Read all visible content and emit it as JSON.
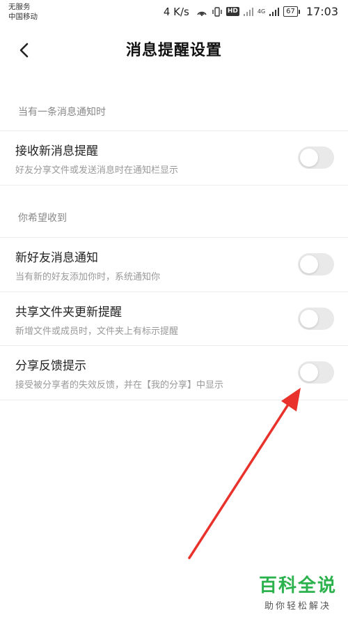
{
  "status_bar": {
    "carrier_line1": "无服务",
    "carrier_line2": "中国移动",
    "net_speed": "4 K/s",
    "hd_label": "HD",
    "net_type": "4G",
    "battery": "67",
    "time": "17:03"
  },
  "header": {
    "title": "消息提醒设置"
  },
  "sections": [
    {
      "label": "当有一条消息通知时",
      "rows": [
        {
          "title": "接收新消息提醒",
          "desc": "好友分享文件或发送消息时在通知栏显示",
          "enabled": false
        }
      ]
    },
    {
      "label": "你希望收到",
      "rows": [
        {
          "title": "新好友消息通知",
          "desc": "当有新的好友添加你时，系统通知你",
          "enabled": false
        },
        {
          "title": "共享文件夹更新提醒",
          "desc": "新增文件或成员时，文件夹上有标示提醒",
          "enabled": false
        },
        {
          "title": "分享反馈提示",
          "desc": "接受被分享者的失效反馈，并在【我的分享】中显示",
          "enabled": false
        }
      ]
    }
  ],
  "watermark": {
    "main": "百科全说",
    "sub": "助你轻松解决"
  },
  "colors": {
    "toggle_off": "#e9e9e9",
    "annotation_arrow": "#e8322b",
    "watermark": "#2bb24c"
  }
}
